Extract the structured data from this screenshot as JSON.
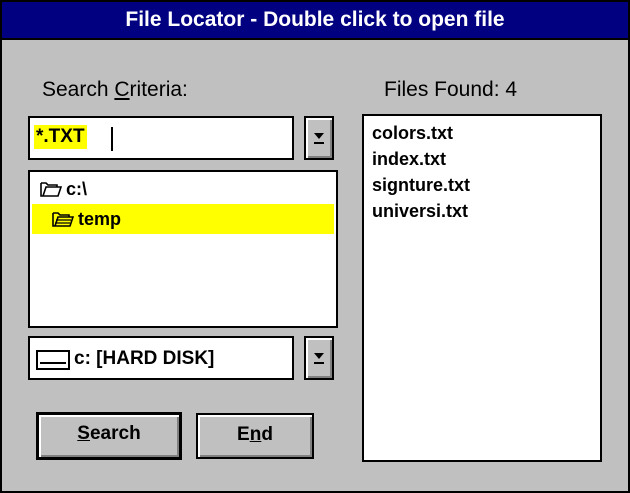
{
  "window": {
    "title": "File Locator - Double click to open file"
  },
  "search_criteria": {
    "label_pre": "Search ",
    "label_accel": "C",
    "label_post": "riteria:",
    "filter_value": "*.TXT"
  },
  "directories": [
    {
      "name": "c:\\",
      "icon": "folder-open-icon",
      "selected": false
    },
    {
      "name": "temp",
      "icon": "folder-open-icon",
      "selected": true
    }
  ],
  "drive": {
    "value": "c: [HARD DISK]",
    "icon": "hard-disk-icon"
  },
  "buttons": {
    "search_accel": "S",
    "search_rest": "earch",
    "end_pre": "E",
    "end_accel": "n",
    "end_post": "d"
  },
  "files_found": {
    "label": "Files Found: 4",
    "files": [
      "colors.txt",
      "index.txt",
      "signture.txt",
      "universi.txt"
    ]
  },
  "colors": {
    "title_bar": "#000080",
    "window_bg": "#c0c0c0",
    "highlight": "#ffff00"
  }
}
